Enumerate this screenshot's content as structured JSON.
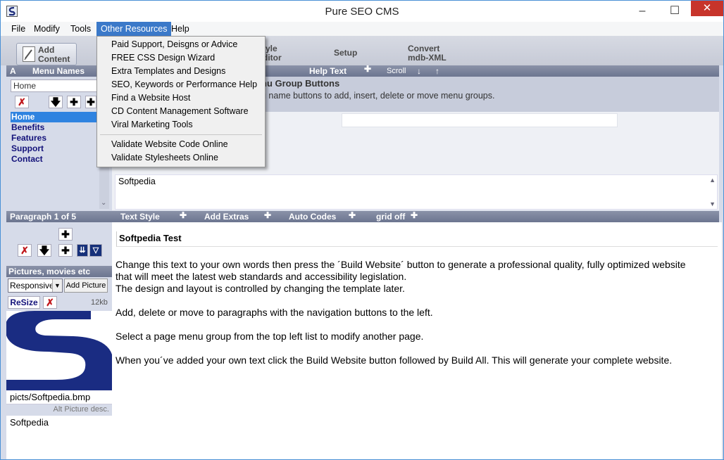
{
  "window": {
    "title": "Pure SEO CMS",
    "minimize": "–",
    "maximize": "☐",
    "close": "✕"
  },
  "menubar": {
    "items": [
      "File",
      "Modify",
      "Tools",
      "Other Resources",
      "Help"
    ]
  },
  "dropdown": {
    "items": [
      "Paid Support, Deisgns or Advice",
      "FREE CSS Design Wizard",
      "Extra Templates and Designs",
      "SEO, Keywords or Performance Help",
      "Find a Website Host",
      "CD Content Management Software",
      "Viral Marketing Tools",
      "Validate Website Code Online",
      "Validate Stylesheets Online"
    ]
  },
  "toolbar": {
    "add_content_1": "Add",
    "add_content_2": "Content",
    "style_editor_1": "tyle",
    "style_editor_2": "ditor",
    "setup": "Setup",
    "convert_1": "Convert",
    "convert_2": "mdb-XML"
  },
  "left": {
    "a_label": "A",
    "menu_names": "Menu Names",
    "home_input": "Home",
    "menu_items": [
      "Home",
      "Benefits",
      "Features",
      "Support",
      "Contact"
    ],
    "paragraph_label": "Paragraph 1 of 5",
    "pictures_label": "Pictures, movies etc",
    "responsive_select": "Responsive",
    "add_picture": "Add Picture",
    "resize": "ReSize",
    "size_kb": "12kb",
    "picture_path": "picts/Softpedia.bmp",
    "alt_label": "Alt Picture desc.",
    "alt_value": "Softpedia"
  },
  "help": {
    "help_text": "Help Text",
    "scroll": "Scroll",
    "heading": "nu Group Buttons",
    "body": "u name buttons to add, insert, delete or move menu groups."
  },
  "editor": {
    "title_box": "Softpedia",
    "text_style": "Text Style",
    "add_extras": "Add Extras",
    "auto_codes": "Auto Codes",
    "grid_off": "grid off",
    "para_title": "Softpedia Test",
    "lines": [
      "Change this text to your own words then press the ´Build Website´ button to generate a professional quality,  fully optimized website",
      "that will meet the latest web standards and accessibility legislation.",
      "The design and layout is controlled by changing the template later.",
      "Add, delete or move to paragraphs with the navigation buttons to the left.",
      "Select a page menu group from the top left list to modify another page.",
      "When you´ve added your own text click the Build Website button followed by Build All. This will generate your complete website."
    ]
  },
  "colors": {
    "accent": "#3b79c9",
    "selected": "#2f83e0",
    "strip": "#7a829b",
    "menu_text": "#13127a",
    "close": "#c7342b"
  }
}
